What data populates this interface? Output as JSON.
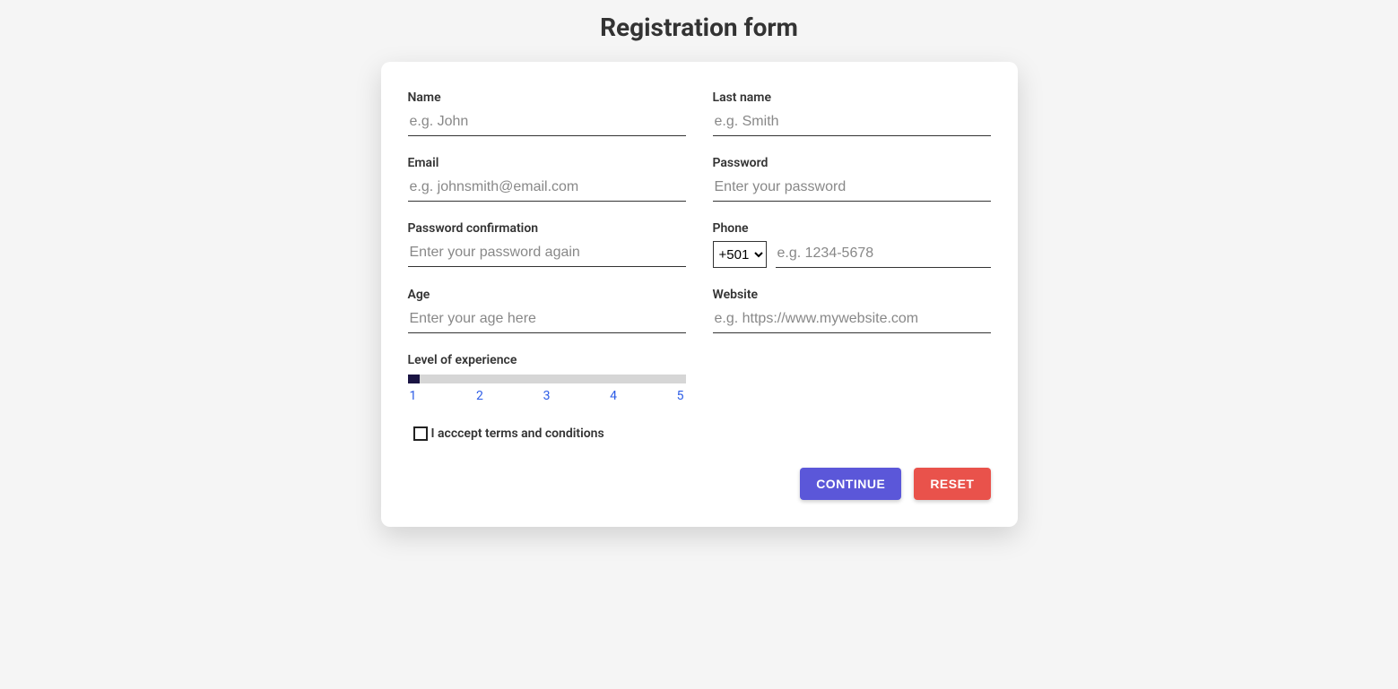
{
  "page": {
    "title": "Registration form"
  },
  "fields": {
    "name": {
      "label": "Name",
      "placeholder": "e.g. John",
      "value": ""
    },
    "lastName": {
      "label": "Last name",
      "placeholder": "e.g. Smith",
      "value": ""
    },
    "email": {
      "label": "Email",
      "placeholder": "e.g. johnsmith@email.com",
      "value": ""
    },
    "password": {
      "label": "Password",
      "placeholder": "Enter your password",
      "value": ""
    },
    "passwordConfirm": {
      "label": "Password confirmation",
      "placeholder": "Enter your password again",
      "value": ""
    },
    "phone": {
      "label": "Phone",
      "countryCode": "+501",
      "placeholder": "e.g. 1234-5678",
      "value": ""
    },
    "age": {
      "label": "Age",
      "placeholder": "Enter your age here",
      "value": ""
    },
    "website": {
      "label": "Website",
      "placeholder": "e.g. https://www.mywebsite.com",
      "value": ""
    },
    "experience": {
      "label": "Level of experience",
      "value": 1,
      "ticks": [
        "1",
        "2",
        "3",
        "4",
        "5"
      ]
    },
    "terms": {
      "label": "I acccept terms and conditions",
      "checked": false
    }
  },
  "buttons": {
    "continue": "CONTINUE",
    "reset": "RESET"
  }
}
